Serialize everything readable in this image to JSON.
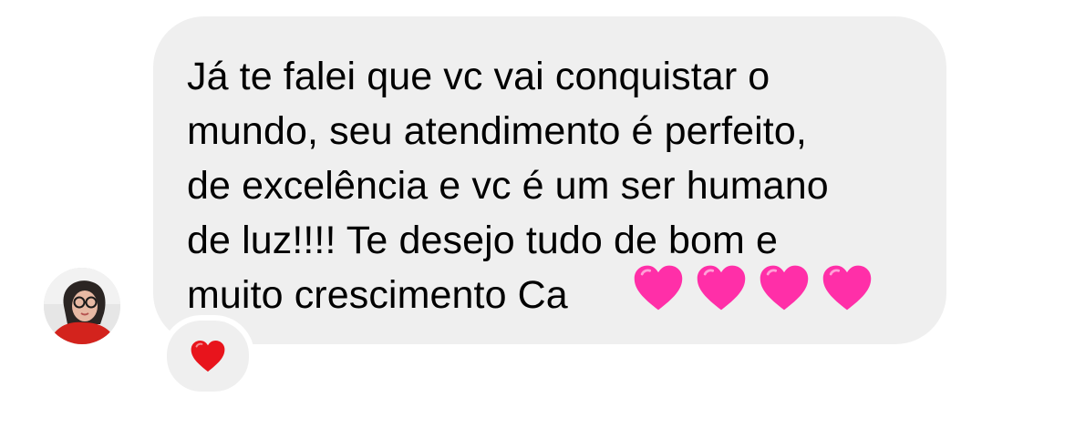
{
  "message": {
    "text": "Já te falei que vc vai conquistar o\nmundo, seu atendimento é perfeito,\nde excelência e vc é um ser humano\nde luz!!!! Te desejo tudo de bom e\nmuito crescimento Ca",
    "emojis": [
      "pink-heart",
      "pink-heart",
      "pink-heart",
      "pink-heart"
    ]
  },
  "reaction": {
    "emoji": "red-heart"
  },
  "colors": {
    "bubble_background": "#efefef",
    "text": "#000000",
    "pink_heart": "#ff2fa8",
    "red_heart": "#e8141c"
  }
}
